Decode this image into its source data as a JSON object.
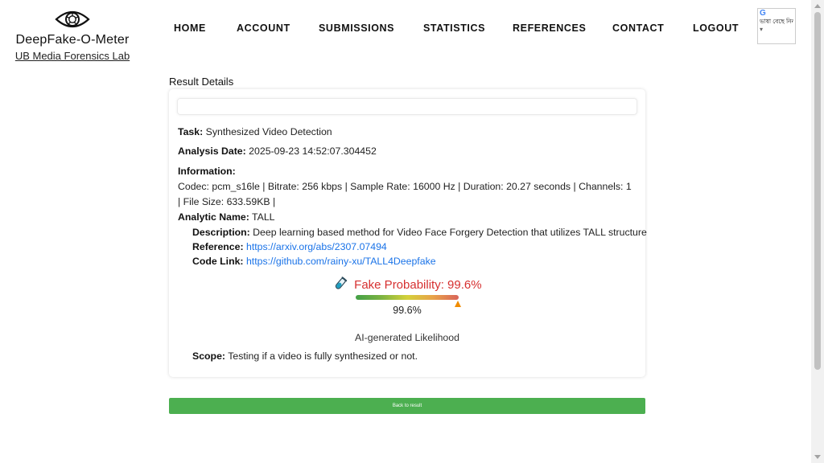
{
  "brand": {
    "title": "DeepFake-O-Meter",
    "lab": "UB Media Forensics Lab",
    "logo_icon": "eye-aperture-icon"
  },
  "nav": {
    "items": [
      "HOME",
      "ACCOUNT",
      "SUBMISSIONS",
      "STATISTICS",
      "REFERENCES",
      "CONTACT",
      "LOGOUT"
    ]
  },
  "translate": {
    "logo": "G",
    "label": "ভাষা বেছে নিন",
    "caret": "▾"
  },
  "result": {
    "title": "Result Details",
    "task_label": "Task:",
    "task": "Synthesized Video Detection",
    "date_label": "Analysis Date:",
    "date": "2025-09-23 14:52:07.304452",
    "info_label": "Information:",
    "info_line1": "Codec: pcm_s16le | Bitrate: 256 kbps | Sample Rate: 16000 Hz | Duration: 20.27 seconds | Channels: 1",
    "info_line2": "| File Size: 633.59KB |",
    "analytic_label": "Analytic Name:",
    "analytic": "TALL",
    "desc_label": "Description:",
    "desc": "Deep learning based method for Video Face Forgery Detection that utilizes TALL structure",
    "ref_label": "Reference:",
    "ref": "https://arxiv.org/abs/2307.07494",
    "code_label": "Code Link:",
    "code": "https://github.com/rainy-xu/TALL4Deepfake",
    "prob_text": "Fake Probability: 99.6%",
    "prob_value": 0.996,
    "pct_text": "99.6%",
    "likelihood": "AI-generated Likelihood",
    "scope_label": "Scope:",
    "scope": "Testing if a video is fully synthesized or not.",
    "prob_color": "#d63030",
    "marker_color": "#f08c00"
  },
  "back_button": "Back to result",
  "accent_green": "#4caf50"
}
